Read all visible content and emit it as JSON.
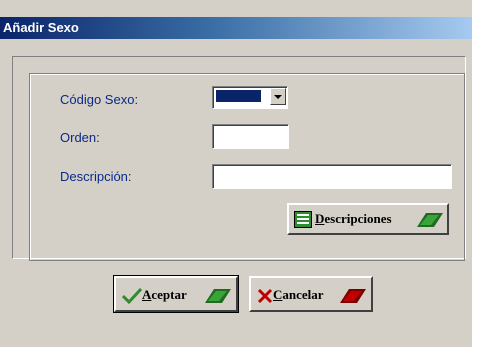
{
  "window": {
    "title": "Añadir Sexo"
  },
  "form": {
    "codigo_label": "Código Sexo:",
    "orden_label": "Orden:",
    "descripcion_label": "Descripción:",
    "orden_value": "",
    "descripcion_value": ""
  },
  "buttons": {
    "descripciones": {
      "hotkey": "D",
      "rest": "escripciones"
    },
    "aceptar": {
      "hotkey": "A",
      "rest": "ceptar"
    },
    "cancelar": {
      "hotkey": "C",
      "rest": "ancelar"
    }
  },
  "colors": {
    "title_gradient_start": "#0a246a",
    "title_gradient_end": "#a6caf0",
    "label_color": "#0a2a8a",
    "dialog_bg": "#d4d0c8",
    "check_green": "#2e8b2e",
    "cancel_red": "#c00000"
  },
  "icons": [
    "list-icon",
    "green-pencil-icon",
    "checkmark-icon",
    "red-x-icon",
    "red-pencil-icon",
    "chevron-down-icon"
  ]
}
